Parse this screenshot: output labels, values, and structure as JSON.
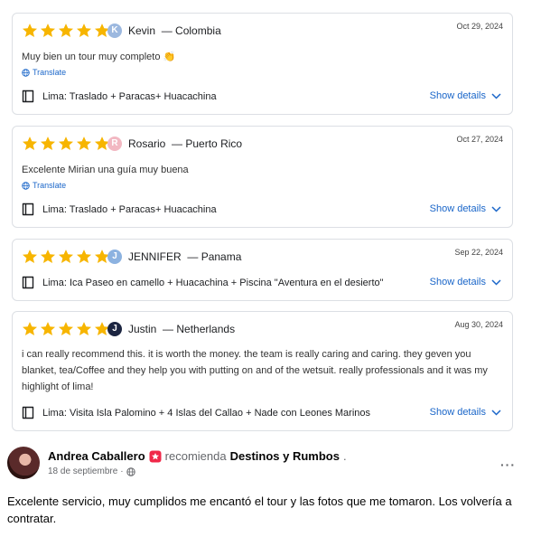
{
  "reviews": [
    {
      "reviewer_initial": "K",
      "reviewer_name": "Kevin",
      "country": "Colombia",
      "date": "Oct 29, 2024",
      "text": "Muy bien un tour muy completo 👏",
      "translate_label": "Translate",
      "tour": "Lima: Traslado + Paracas+ Huacachina",
      "show_details_label": "Show details",
      "avatar_color": "#9cb8df",
      "rating": 5
    },
    {
      "reviewer_initial": "R",
      "reviewer_name": "Rosario",
      "country": "Puerto Rico",
      "date": "Oct 27, 2024",
      "text": "Excelente Mirian una guía muy buena",
      "translate_label": "Translate",
      "tour": "Lima: Traslado + Paracas+ Huacachina",
      "show_details_label": "Show details",
      "avatar_color": "#f2b8c2",
      "rating": 5
    },
    {
      "reviewer_initial": "J",
      "reviewer_name": "JENNIFER",
      "country": "Panama",
      "date": "Sep 22, 2024",
      "tour": "Lima: Ica Paseo en camello + Huacachina + Piscina \"Aventura en el desierto\"",
      "show_details_label": "Show details",
      "avatar_color": "#8cb2e0",
      "rating": 5
    },
    {
      "reviewer_initial": "J",
      "reviewer_name": "Justin",
      "country": "Netherlands",
      "date": "Aug 30, 2024",
      "text": "i can really recommend this. it is worth the money. the team is really caring and caring. they geven you blanket, tea/Coffee and they help you with putting on and of the wetsuit. really professionals and it was my highlight of lima!",
      "tour": "Lima: Visita Isla Palomino + 4 Islas del Callao + Nade con Leones Marinos",
      "show_details_label": "Show details",
      "avatar_color": "#1c2541",
      "rating": 5
    }
  ],
  "colors": {
    "star": "#f7b500",
    "link": "#1a66c9",
    "badge": "#f02849"
  },
  "post": {
    "author": "Andrea Caballero",
    "verb": "recomienda",
    "page": "Destinos y Rumbos",
    "page_suffix": ".",
    "date": "18 de septiembre",
    "separator": "·",
    "more_label": "···",
    "text": "Excelente servicio, muy cumplidos me encantó el tour y las fotos que me tomaron. Los volvería a contratar."
  }
}
